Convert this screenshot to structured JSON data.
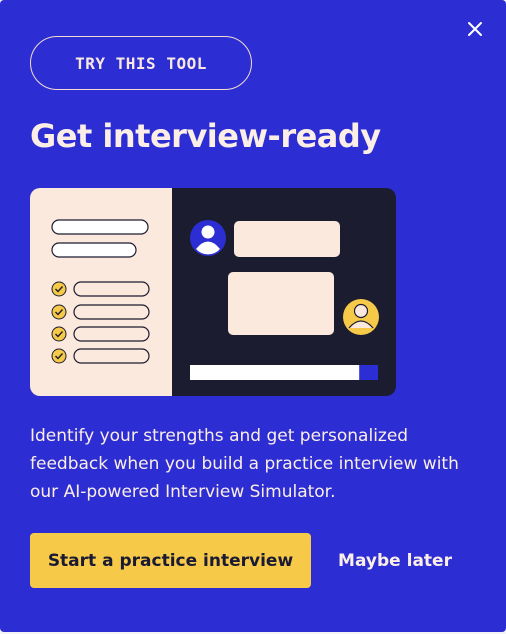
{
  "modal": {
    "badge_label": "TRY THIS TOOL",
    "title": "Get interview-ready",
    "description": "Identify your strengths and get personalized feedback when you build a practice interview with our AI-powered Interview Simulator.",
    "primary_button_label": "Start a practice interview",
    "secondary_button_label": "Maybe later",
    "close_icon": "close-icon",
    "illustration": {
      "checklist_items_checked": 4,
      "progress_fraction": 0.9
    }
  },
  "colors": {
    "background": "#2c2ed3",
    "accent_yellow": "#f7c948",
    "cream": "#fbeee7",
    "dark_panel": "#1c1c30"
  }
}
